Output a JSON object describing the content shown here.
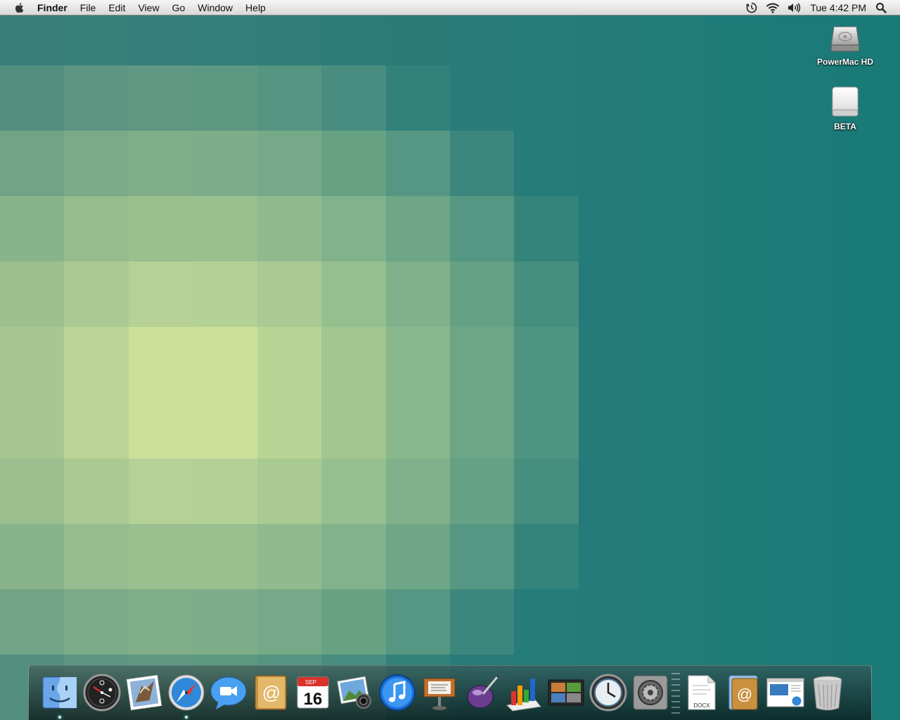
{
  "menubar": {
    "app_name": "Finder",
    "menus": [
      "File",
      "Edit",
      "View",
      "Go",
      "Window",
      "Help"
    ],
    "status_icons": [
      "time-machine-icon",
      "wifi-icon",
      "volume-icon"
    ],
    "clock": "Tue 4:42 PM"
  },
  "desktop": {
    "icons": [
      {
        "label": "PowerMac HD",
        "icon": "hard-drive-icon"
      },
      {
        "label": "BETA",
        "icon": "external-drive-icon"
      }
    ]
  },
  "dock": {
    "apps": [
      {
        "icon": "finder-icon",
        "running": true
      },
      {
        "icon": "dashboard-icon",
        "running": false
      },
      {
        "icon": "mail-stamp-icon",
        "running": false
      },
      {
        "icon": "safari-icon",
        "running": true
      },
      {
        "icon": "ichat-icon",
        "running": false
      },
      {
        "icon": "address-book-icon",
        "running": false
      },
      {
        "icon": "calendar-icon",
        "running": false,
        "month": "SEP",
        "day": "16"
      },
      {
        "icon": "iphoto-icon",
        "running": false
      },
      {
        "icon": "itunes-icon",
        "running": false
      },
      {
        "icon": "keynote-icon",
        "running": false
      },
      {
        "icon": "pages-pen-icon",
        "running": false
      },
      {
        "icon": "numbers-icon",
        "running": false
      },
      {
        "icon": "photo-browser-icon",
        "running": false
      },
      {
        "icon": "time-machine-icon",
        "running": false
      },
      {
        "icon": "system-preferences-icon",
        "running": false
      }
    ],
    "stacks": [
      {
        "icon": "docx-document-icon",
        "label": "DOCX"
      },
      {
        "icon": "applications-folder-icon"
      },
      {
        "icon": "web-preview-icon"
      },
      {
        "icon": "trash-icon"
      }
    ]
  },
  "colors": {
    "wallpaper_top_left": "#3a7e7a",
    "wallpaper_highlight": "#dceb9d",
    "wallpaper_right": "#1a7a78"
  }
}
